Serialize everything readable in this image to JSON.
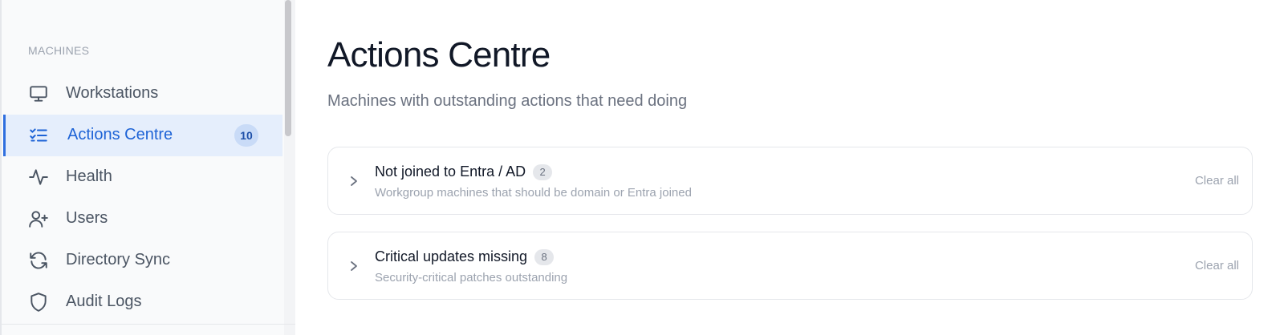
{
  "sidebar": {
    "section_label": "MACHINES",
    "items": [
      {
        "label": "Workstations",
        "icon": "monitor-icon"
      },
      {
        "label": "Actions Centre",
        "icon": "checklist-icon",
        "badge": "10",
        "active": true
      },
      {
        "label": "Health",
        "icon": "activity-icon"
      },
      {
        "label": "Users",
        "icon": "user-plus-icon"
      },
      {
        "label": "Directory Sync",
        "icon": "refresh-icon"
      },
      {
        "label": "Audit Logs",
        "icon": "shield-icon"
      }
    ]
  },
  "main": {
    "title": "Actions Centre",
    "subtitle": "Machines with outstanding actions that need doing",
    "cards": [
      {
        "title": "Not joined to Entra / AD",
        "count": "2",
        "description": "Workgroup machines that should be domain or Entra joined",
        "action": "Clear all"
      },
      {
        "title": "Critical updates missing",
        "count": "8",
        "description": "Security-critical patches outstanding",
        "action": "Clear all"
      }
    ]
  },
  "colors": {
    "accent": "#1d63d6",
    "active_bg": "#e5eefc",
    "badge_bg": "#c9dbf7"
  }
}
